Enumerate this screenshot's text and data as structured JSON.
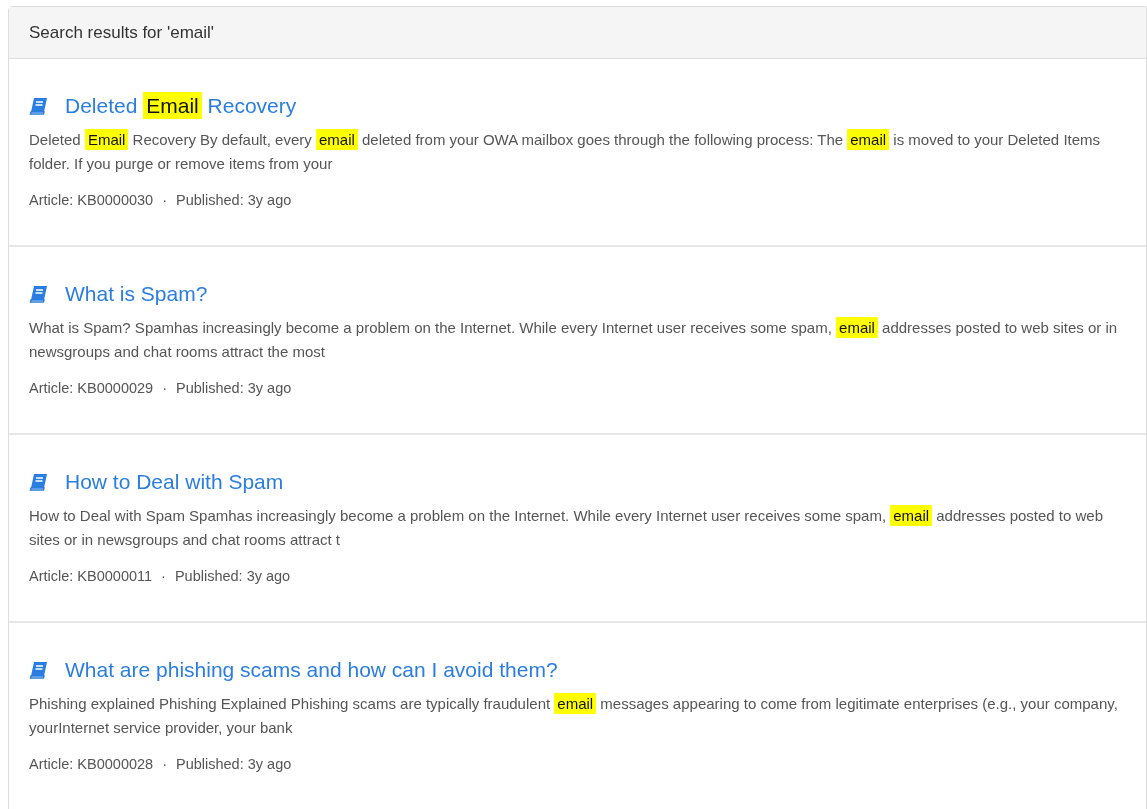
{
  "header": {
    "title": "Search results for 'email'"
  },
  "results": [
    {
      "title": [
        {
          "text": "Deleted ",
          "highlighted": false
        },
        {
          "text": "Email",
          "highlighted": true
        },
        {
          "text": " Recovery",
          "highlighted": false
        }
      ],
      "snippet": [
        {
          "text": "Deleted ",
          "highlighted": false
        },
        {
          "text": "Email",
          "highlighted": true
        },
        {
          "text": " Recovery By default, every ",
          "highlighted": false
        },
        {
          "text": "email",
          "highlighted": true
        },
        {
          "text": " deleted from your OWA mailbox goes through the following process: The ",
          "highlighted": false
        },
        {
          "text": "email",
          "highlighted": true
        },
        {
          "text": " is moved to your Deleted Items folder. If you purge or remove items from your",
          "highlighted": false
        }
      ],
      "article": "Article: KB0000030",
      "separator": "·",
      "published": "Published: 3y ago"
    },
    {
      "title": [
        {
          "text": "What is Spam?",
          "highlighted": false
        }
      ],
      "snippet": [
        {
          "text": "What is Spam? Spamhas increasingly become a problem on the Internet. While every Internet user receives some spam, ",
          "highlighted": false
        },
        {
          "text": "email",
          "highlighted": true
        },
        {
          "text": " addresses posted to web sites or in newsgroups and chat rooms attract the most",
          "highlighted": false
        }
      ],
      "article": "Article: KB0000029",
      "separator": "·",
      "published": "Published: 3y ago"
    },
    {
      "title": [
        {
          "text": "How to Deal with Spam",
          "highlighted": false
        }
      ],
      "snippet": [
        {
          "text": "How to Deal with Spam Spamhas increasingly become a problem on the Internet. While every Internet user receives some spam, ",
          "highlighted": false
        },
        {
          "text": "email",
          "highlighted": true
        },
        {
          "text": " addresses posted to web sites or in newsgroups and chat rooms attract t",
          "highlighted": false
        }
      ],
      "article": "Article: KB0000011",
      "separator": "·",
      "published": "Published: 3y ago"
    },
    {
      "title": [
        {
          "text": "What are phishing scams and how can I avoid them?",
          "highlighted": false
        }
      ],
      "snippet": [
        {
          "text": "Phishing explained Phishing Explained Phishing scams are typically fraudulent ",
          "highlighted": false
        },
        {
          "text": "email",
          "highlighted": true
        },
        {
          "text": " messages appearing to come from legitimate enterprises (e.g., your company, yourInternet service provider, your bank",
          "highlighted": false
        }
      ],
      "article": "Article: KB0000028",
      "separator": "·",
      "published": "Published: 3y ago"
    }
  ]
}
